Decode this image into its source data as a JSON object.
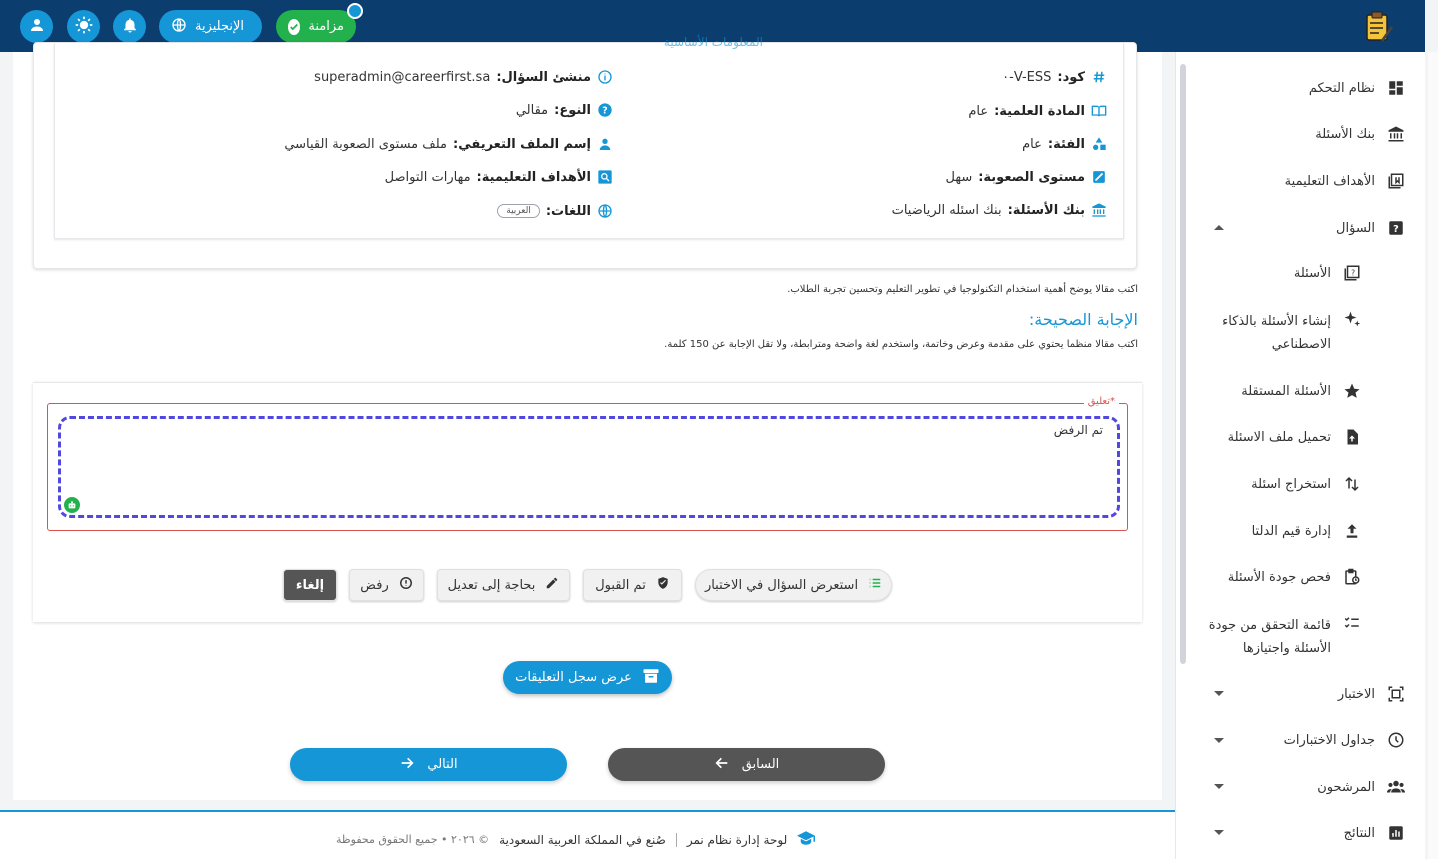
{
  "topbar": {
    "sync_label": "مزامنة",
    "language_label": "الإنجليزية"
  },
  "sidebar": {
    "items": [
      {
        "label": "نظام التحكم"
      },
      {
        "label": "بنك الأسئلة"
      },
      {
        "label": "الأهداف التعليمية"
      },
      {
        "label": "السؤال"
      },
      {
        "label": "الأسئلة"
      },
      {
        "label": "إنشاء الأسئلة بالذكاء الاصطناعي"
      },
      {
        "label": "الأسئلة المستقلة"
      },
      {
        "label": "تحميل ملف الاسئلة"
      },
      {
        "label": "استخراج اسئلة"
      },
      {
        "label": "إدارة قيم الدلتا"
      },
      {
        "label": "فحص جودة الأسئلة"
      },
      {
        "label": "قائمة التحقق من جودة الأسئلة واجتيازها"
      },
      {
        "label": "الاختبار"
      },
      {
        "label": "جداول الاختبارات"
      },
      {
        "label": "المرشحون"
      },
      {
        "label": "النتائج"
      }
    ]
  },
  "info": {
    "section_title": "المعلومات الأساسية",
    "code_label": "كود:",
    "code_value": "V-ESS-٠",
    "creator_label": "منشئ السؤال:",
    "creator_value": "superadmin@careerfirst.sa",
    "subject_label": "المادة العلمية:",
    "subject_value": "عام",
    "type_label": "النوع:",
    "type_value": "مقالي",
    "category_label": "الفئة:",
    "category_value": "عام",
    "profile_label": "إسم الملف التعريفي:",
    "profile_value": "ملف مستوى الصعوبة القياسي",
    "difficulty_label": "مستوى الصعوبة:",
    "difficulty_value": "سهل",
    "objectives_label": "الأهداف التعليمية:",
    "objectives_value": "مهارات التواصل",
    "bank_label": "بنك الأسئلة:",
    "bank_value": "بنك اسئله الرياضيات",
    "languages_label": "اللغات:",
    "languages_value": "العربية"
  },
  "question": {
    "text": "اكتب مقالا يوضح أهمية استخدام التكنولوجيا في تطوير التعليم وتحسين تجربة الطلاب.",
    "answer_title": "الإجابة الصحيحة:",
    "answer_text": "اكتب مقالا منظما يحتوي على مقدمة وعرض وخاتمة، واستخدم لغة واضحة ومترابطة، ولا تقل الإجابة عن 150 كلمة."
  },
  "review": {
    "comment_label": "تعليق*",
    "comment_value": "تم الرفض",
    "buttons": {
      "preview": "استعرض السؤال في الاختبار",
      "accepted": "تم القبول",
      "needs_edit": "بحاجة إلى تعديل",
      "reject": "رفض",
      "cancel": "إلغاء"
    }
  },
  "actions": {
    "history": "عرض سجل التعليقات",
    "previous": "السابق",
    "next": "التالي"
  },
  "footer": {
    "brand": "لوحة إدارة نظام نمر",
    "made_in": "صُنع في المملكة العربية السعودية",
    "copyright": "© ٢٠٢٦ • جميع الحقوق محفوظة"
  },
  "colors": {
    "topbar": "#0b3d6e",
    "accent": "#1596d6",
    "success": "#22b14c",
    "error": "#d9534f",
    "focus": "#5148e0"
  }
}
